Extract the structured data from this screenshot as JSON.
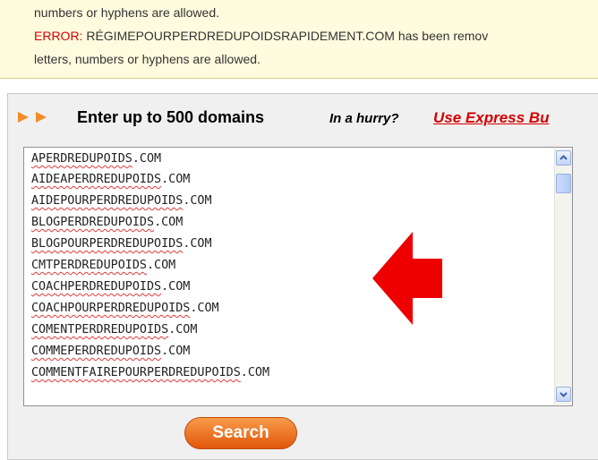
{
  "errors": [
    {
      "label": "",
      "text": "numbers or hyphens are allowed."
    },
    {
      "label": "ERROR:",
      "text": " RÉGIMEPOURPERDREDUPOIDSRAPIDEMENT.COM has been remov"
    },
    {
      "label": "",
      "text": "letters, numbers or hyphens are allowed."
    }
  ],
  "panel": {
    "title": "Enter up to 500 domains",
    "hurry_text": "In a hurry?",
    "express_link": "Use Express Bu"
  },
  "domains": [
    {
      "name": "APERDREDUPOIDS",
      "tld": ".COM"
    },
    {
      "name": "AIDEAPERDREDUPOIDS",
      "tld": ".COM"
    },
    {
      "name": "AIDEPOURPERDREDUPOIDS",
      "tld": ".COM"
    },
    {
      "name": "BLOGPERDREDUPOIDS",
      "tld": ".COM"
    },
    {
      "name": "BLOGPOURPERDREDUPOIDS",
      "tld": ".COM"
    },
    {
      "name": "CMTPERDREDUPOIDS",
      "tld": ".COM"
    },
    {
      "name": "COACHPERDREDUPOIDS",
      "tld": ".COM"
    },
    {
      "name": "COACHPOURPERDREDUPOIDS",
      "tld": ".COM"
    },
    {
      "name": "COMENTPERDREDUPOIDS",
      "tld": ".COM"
    },
    {
      "name": "COMMEPERDREDUPOIDS",
      "tld": ".COM"
    },
    {
      "name": "COMMENTFAIREPOURPERDREDUPOIDS",
      "tld": ".COM"
    }
  ],
  "search_button": "Search",
  "colors": {
    "error_bg": "#fffbdf",
    "error_label": "#d70000",
    "link": "#d30000",
    "accent_orange": "#f28c28",
    "arrow_red": "#ee0000"
  },
  "icons": {
    "header": "double-orange-triangle-arrows",
    "scroll_up": "chevron-up",
    "scroll_down": "chevron-down",
    "callout": "big-red-left-arrow"
  }
}
